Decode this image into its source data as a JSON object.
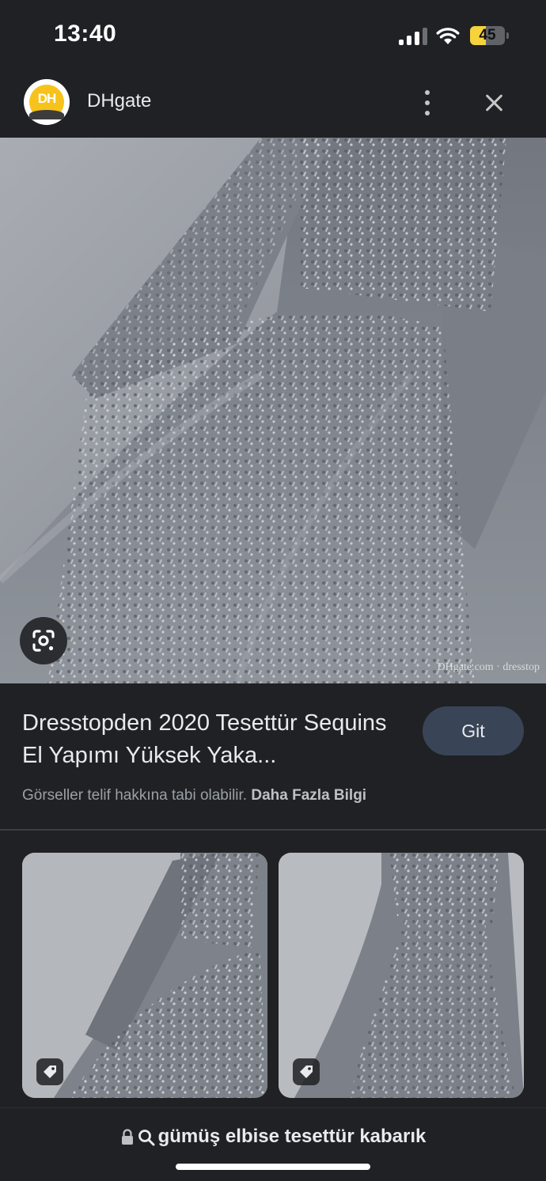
{
  "status_bar": {
    "time": "13:40",
    "battery_level": "45",
    "battery_fraction": 0.45,
    "icons": [
      "signal-icon",
      "wifi-icon",
      "battery-icon"
    ]
  },
  "header": {
    "logo_text": "DH",
    "site_name": "DHgate",
    "icons": [
      "more-vert-icon",
      "close-icon"
    ]
  },
  "main_image": {
    "watermark": "DHgate.com · dresstop",
    "lens_icon": "google-lens-icon"
  },
  "result": {
    "title": "Dresstopden 2020 Tesettür Sequins El Yapımı Yüksek Yaka...",
    "go_button_label": "Git",
    "copyright_text": "Görseller telif hakkına tabi olabilir.",
    "more_info_link": "Daha Fazla Bilgi"
  },
  "related": {
    "items": [
      {
        "badge_icon": "price-tag-icon"
      },
      {
        "badge_icon": "price-tag-icon"
      }
    ]
  },
  "bottom_bar": {
    "query": "gümüş elbise tesettür kabarık",
    "icons": [
      "lock-icon",
      "search-icon"
    ]
  },
  "colors": {
    "background": "#202124",
    "button_bg": "#394457",
    "battery_accent": "#f6d33d",
    "logo_yellow": "#f7c21b",
    "dress_gray": "#8e939a"
  }
}
